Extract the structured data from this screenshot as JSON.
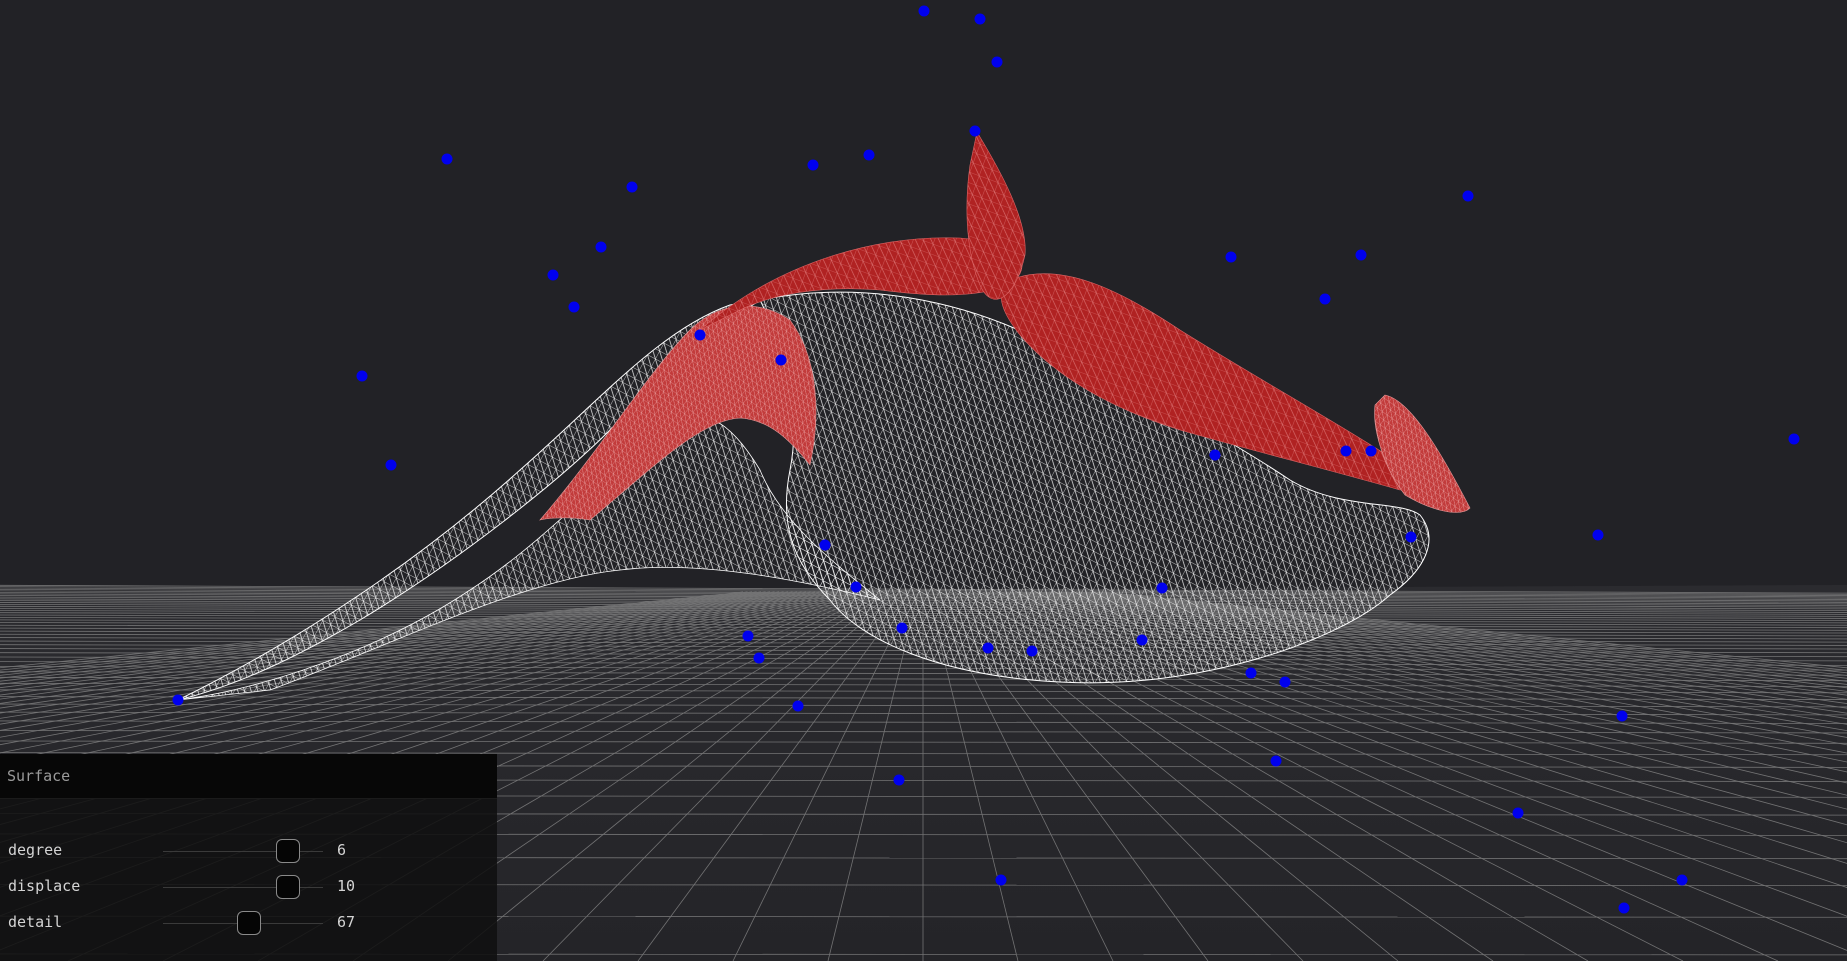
{
  "app": {
    "background_color": "#222226",
    "surface_wire_color": "#ffffff",
    "surface_fill_color": "#b02222",
    "control_point_color": "#0000ee",
    "ground_grid_color": "#888888"
  },
  "panel": {
    "title": "Surface",
    "controls": [
      {
        "label": "degree",
        "value": "6",
        "level": 0.78
      },
      {
        "label": "displace",
        "value": "10",
        "level": 0.78
      },
      {
        "label": "detail",
        "value": "67",
        "level": 0.54
      }
    ]
  }
}
